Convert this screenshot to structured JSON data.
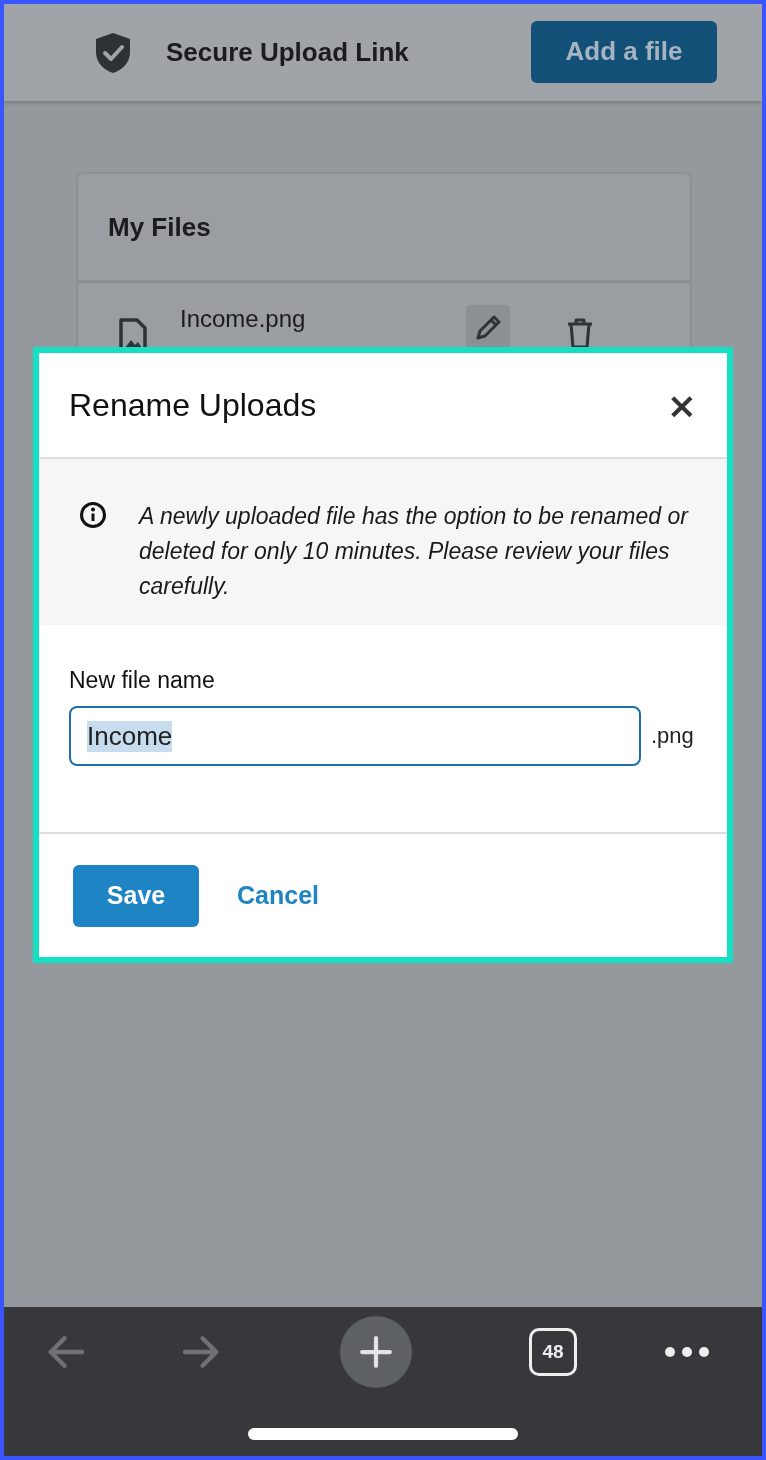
{
  "header": {
    "title": "Secure Upload Link",
    "add_button": "Add a file"
  },
  "files_card": {
    "title": "My Files",
    "files": [
      {
        "name": "Income.png"
      }
    ]
  },
  "dialog": {
    "title": "Rename Uploads",
    "close": "×",
    "notice": "A newly uploaded file has the option to be renamed or deleted for only 10 minutes. Please review your files carefully.",
    "field_label": "New file name",
    "value": "Income",
    "text_selected": true,
    "extension": ".png",
    "buttons": [
      {
        "kind": "primary",
        "label": "Save"
      },
      {
        "kind": "link",
        "label": "Cancel"
      }
    ]
  },
  "browser_toolbar": {
    "back_disabled": true,
    "forward_disabled": true,
    "tab_count": "48"
  }
}
